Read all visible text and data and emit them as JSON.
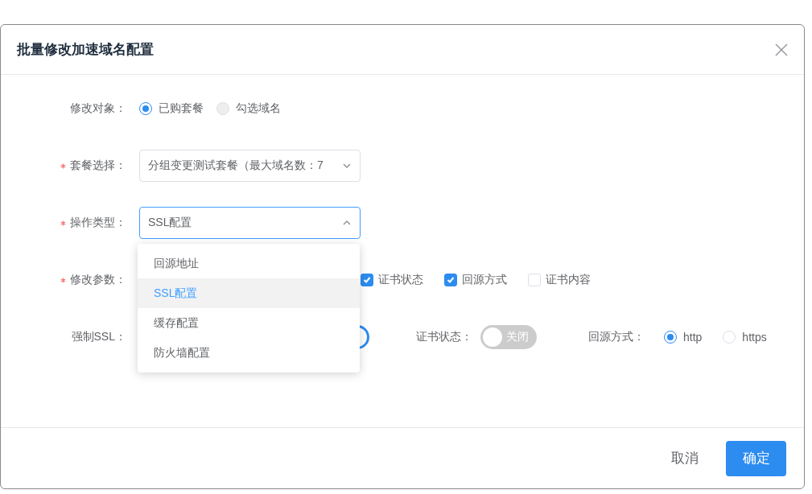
{
  "dialog": {
    "title": "批量修改加速域名配置"
  },
  "form": [
    {
      "kind": "radio",
      "label": "修改对象：",
      "required": false,
      "options": [
        {
          "label": "已购套餐",
          "selected": true,
          "disabled": false
        },
        {
          "label": "勾选域名",
          "selected": false,
          "disabled": true
        }
      ]
    },
    {
      "kind": "select",
      "label": "套餐选择：",
      "required": true,
      "value": "分组变更测试套餐（最大域名数：7",
      "open": false
    },
    {
      "kind": "select",
      "label": "操作类型：",
      "required": true,
      "value": "SSL配置",
      "open": true
    },
    {
      "kind": "checkboxes",
      "label": "修改参数：",
      "required": true,
      "options": [
        {
          "label": "证书状态",
          "checked": true
        },
        {
          "label": "回源方式",
          "checked": true
        },
        {
          "label": "证书内容",
          "checked": false
        }
      ]
    },
    {
      "kind": "inline",
      "fields": [
        {
          "kind": "switch",
          "label": "强制SSL：",
          "on": true
        },
        {
          "kind": "switch",
          "label": "证书状态：",
          "on": false,
          "text": "关闭"
        },
        {
          "kind": "radio",
          "label": "回源方式：",
          "options": [
            {
              "label": "http",
              "selected": true,
              "disabled": false
            },
            {
              "label": "https",
              "selected": false,
              "disabled": false
            }
          ]
        }
      ]
    }
  ],
  "dropdown": {
    "items": [
      {
        "label": "回源地址",
        "selected": false
      },
      {
        "label": "SSL配置",
        "selected": true
      },
      {
        "label": "缓存配置",
        "selected": false
      },
      {
        "label": "防火墙配置",
        "selected": false
      }
    ]
  },
  "footer": {
    "buttons": [
      {
        "label": "取消",
        "kind": "text"
      },
      {
        "label": "确定",
        "kind": "primary"
      }
    ]
  }
}
